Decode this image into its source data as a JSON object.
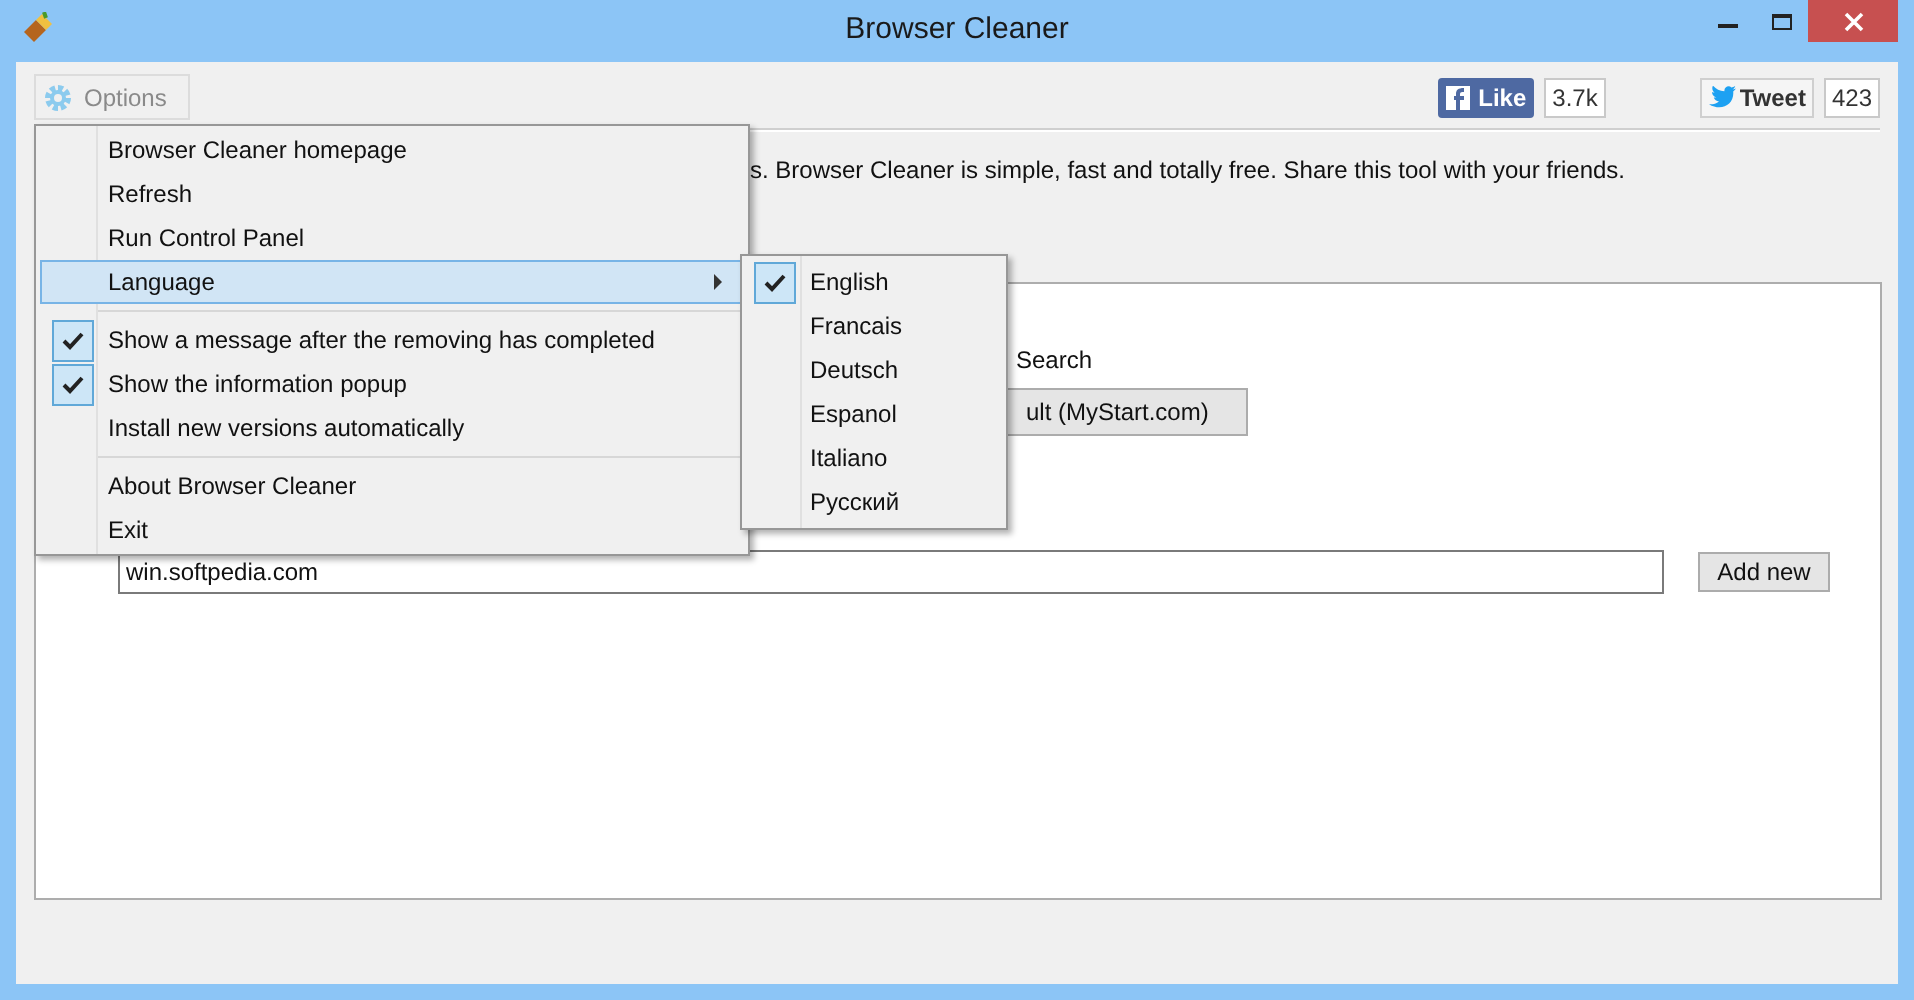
{
  "window": {
    "title": "Browser Cleaner"
  },
  "toolbar": {
    "options_button": "Options",
    "like": {
      "label": "Like",
      "count": "3.7k"
    },
    "tweet": {
      "label": "Tweet",
      "count": "423"
    }
  },
  "description": "s. Browser Cleaner is simple, fast and totally free. Share this tool with your friends.",
  "panel": {
    "search_label": "Search",
    "default_button": "ult (MyStart.com)",
    "url_field": {
      "value": "win.softpedia.com"
    },
    "add_button": "Add new"
  },
  "menu": {
    "items": [
      {
        "kind": "item",
        "label": "Browser Cleaner homepage",
        "selected": false
      },
      {
        "kind": "item",
        "label": "Refresh",
        "selected": false
      },
      {
        "kind": "item",
        "label": "Run Control Panel",
        "selected": false
      },
      {
        "kind": "submenu",
        "label": "Language",
        "selected": true
      },
      {
        "kind": "separator"
      },
      {
        "kind": "check",
        "label": "Show a message after the removing has completed",
        "selected": false,
        "checked": true
      },
      {
        "kind": "check",
        "label": "Show the information popup",
        "selected": false,
        "checked": true
      },
      {
        "kind": "check",
        "label": "Install new versions automatically",
        "selected": false,
        "checked": false
      },
      {
        "kind": "separator"
      },
      {
        "kind": "item",
        "label": "About Browser Cleaner",
        "selected": false
      },
      {
        "kind": "item",
        "label": "Exit",
        "selected": false
      }
    ]
  },
  "language_menu": {
    "items": [
      {
        "label": "English",
        "checked": true
      },
      {
        "label": "Francais",
        "checked": false
      },
      {
        "label": "Deutsch",
        "checked": false
      },
      {
        "label": "Espanol",
        "checked": false
      },
      {
        "label": "Italiano",
        "checked": false
      },
      {
        "label": "Русский",
        "checked": false
      }
    ]
  }
}
